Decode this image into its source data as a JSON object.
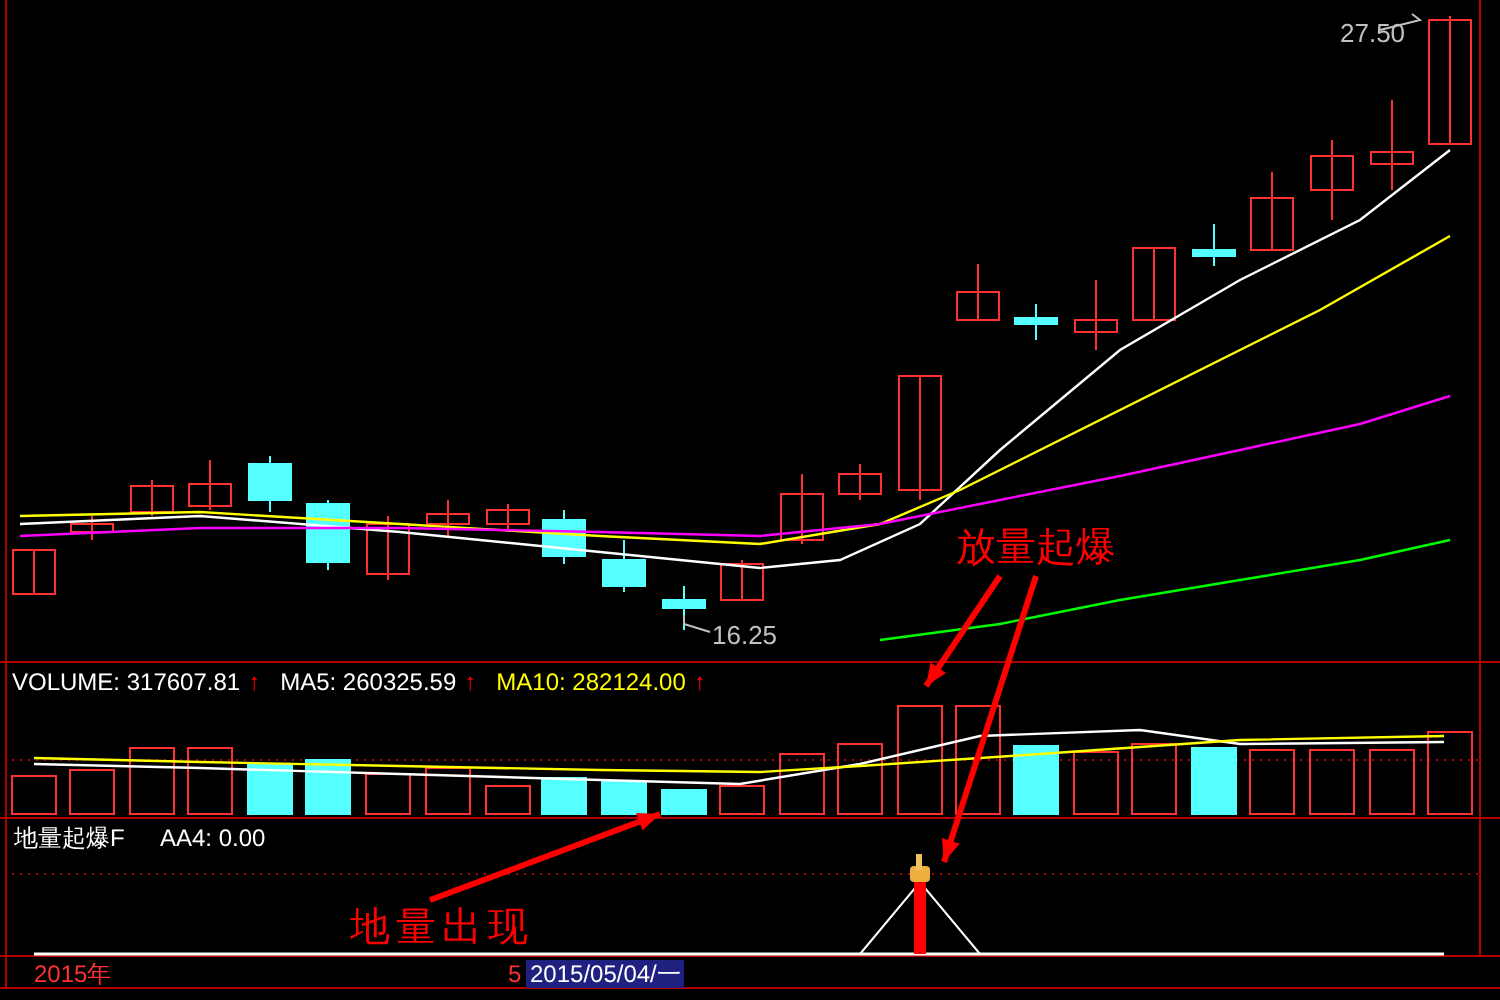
{
  "price_panel": {
    "high_label": "27.50",
    "low_label": "16.25"
  },
  "volume_panel": {
    "indicators": [
      {
        "text": "VOLUME: 317607.81",
        "arrow": "↑",
        "color": "#ffffff"
      },
      {
        "text": "MA5: 260325.59",
        "arrow": "↑",
        "color": "#ffffff"
      },
      {
        "text": "MA10: 282124.00",
        "arrow": "↑",
        "color": "#ffff00"
      }
    ]
  },
  "indicator_panel": {
    "title": "地量起爆F",
    "value": "AA4: 0.00"
  },
  "time_axis": {
    "year": "2015年",
    "marker": "5",
    "date": "2015/05/04/一"
  },
  "annotations": [
    {
      "text": "放量起爆"
    },
    {
      "text": "地量出现"
    }
  ]
}
